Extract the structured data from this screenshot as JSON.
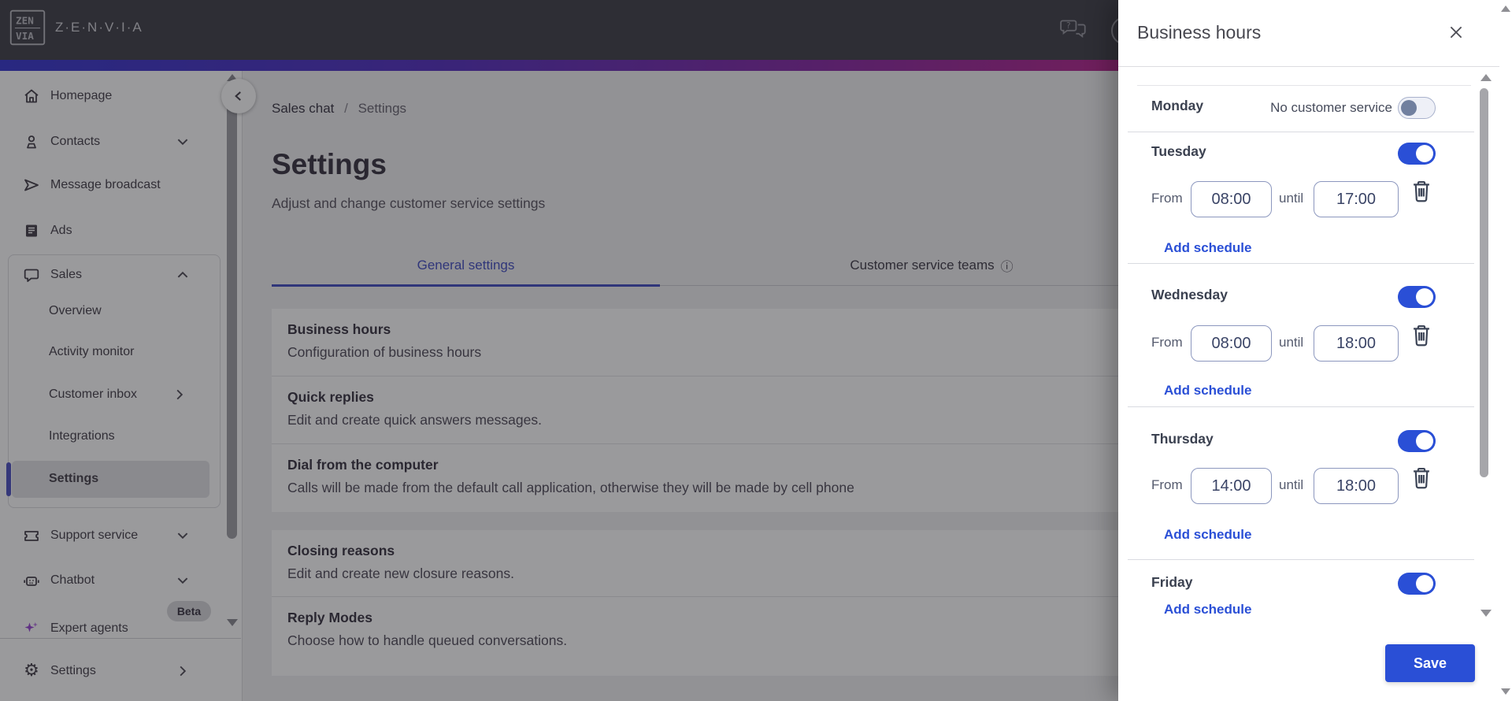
{
  "topbar": {
    "brand": "Z·E·N·V·I·A"
  },
  "sidebar": {
    "items": [
      {
        "icon": "home-icon",
        "label": "Homepage"
      },
      {
        "icon": "contacts-icon",
        "label": "Contacts",
        "chevron": "down"
      },
      {
        "icon": "send-icon",
        "label": "Message broadcast"
      },
      {
        "icon": "ads-icon",
        "label": "Ads"
      },
      {
        "icon": "sales-icon",
        "label": "Sales",
        "chevron": "up",
        "expanded": true,
        "children": [
          {
            "label": "Overview"
          },
          {
            "label": "Activity monitor"
          },
          {
            "label": "Customer inbox",
            "chevron": "right"
          },
          {
            "label": "Integrations"
          },
          {
            "label": "Settings",
            "selected": true
          }
        ]
      },
      {
        "icon": "ticket-icon",
        "label": "Support service",
        "chevron": "down"
      },
      {
        "icon": "chatbot-icon",
        "label": "Chatbot",
        "chevron": "down"
      },
      {
        "icon": "sparkles-icon",
        "label": "Expert agents",
        "badge": "Beta"
      }
    ],
    "footer": {
      "icon": "gear-icon",
      "label": "Settings",
      "chevron": "right"
    }
  },
  "breadcrumb": {
    "parent": "Sales chat",
    "separator": "/",
    "current": "Settings"
  },
  "page": {
    "title": "Settings",
    "subtitle": "Adjust and change customer service settings"
  },
  "tabs": [
    {
      "label": "General settings",
      "active": true
    },
    {
      "label": "Customer service teams",
      "active": false,
      "info_icon": true
    }
  ],
  "settings_rows": [
    {
      "title": "Business hours",
      "description": "Configuration of business hours"
    },
    {
      "title": "Quick replies",
      "description": "Edit and create quick answers messages."
    },
    {
      "title": "Dial from the computer",
      "description": "Calls will be made from the default call application, otherwise they will be made by cell phone"
    },
    {
      "title": "Closing reasons",
      "description": "Edit and create new closure reasons."
    },
    {
      "title": "Reply Modes",
      "description": "Choose how to handle queued conversations."
    }
  ],
  "panel": {
    "title": "Business hours",
    "labels": {
      "from": "From",
      "until": "until",
      "add_schedule": "Add schedule"
    },
    "days": [
      {
        "name": "Monday",
        "enabled": false,
        "off_label": "No customer service"
      },
      {
        "name": "Tuesday",
        "enabled": true,
        "from": "08:00",
        "until": "17:00"
      },
      {
        "name": "Wednesday",
        "enabled": true,
        "from": "08:00",
        "until": "18:00"
      },
      {
        "name": "Thursday",
        "enabled": true,
        "from": "14:00",
        "until": "18:00"
      },
      {
        "name": "Friday",
        "enabled": true
      }
    ],
    "save_label": "Save"
  },
  "icons": {
    "gear": "⚙",
    "info": "ⓘ"
  },
  "colors": {
    "accent_blue": "#2a4fd6",
    "sidebar_indicator": "#5356c5",
    "active_tab": "#4954c4",
    "topbar_bg": "#45454f",
    "toggle_off_knob": "#71809f",
    "beta_badge_bg": "#d9d9dd",
    "gradient": [
      "#3c3cd0",
      "#5a35c2",
      "#8c2ea6",
      "#c62a8a",
      "#ee3d78"
    ]
  }
}
